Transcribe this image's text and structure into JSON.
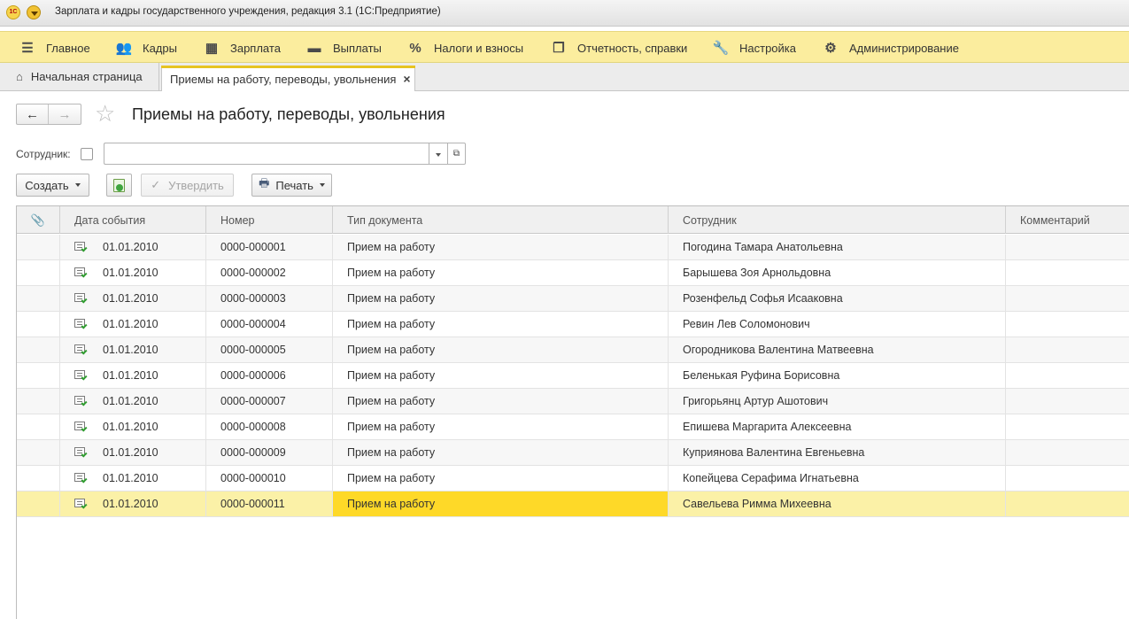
{
  "app": {
    "title": "Зарплата и кадры государственного учреждения, редакция 3.1  (1С:Предприятие)",
    "logo_text": "1С"
  },
  "sections": [
    {
      "label": "Главное",
      "icon": "hamburger-menu-icon"
    },
    {
      "label": "Кадры",
      "icon": "people-icon"
    },
    {
      "label": "Зарплата",
      "icon": "calculator-icon"
    },
    {
      "label": "Выплаты",
      "icon": "wallet-icon"
    },
    {
      "label": "Налоги и взносы",
      "icon": "percent-icon"
    },
    {
      "label": "Отчетность, справки",
      "icon": "reports-icon"
    },
    {
      "label": "Настройка",
      "icon": "wrench-icon"
    },
    {
      "label": "Администрирование",
      "icon": "gear-icon"
    }
  ],
  "tabs": {
    "home": "Начальная страница",
    "active": "Приемы на работу, переводы, увольнения",
    "close_glyph": "×"
  },
  "form": {
    "title": "Приемы на работу, переводы, увольнения",
    "filter_label": "Сотрудник:",
    "filter_value": "",
    "filter_checked": false
  },
  "toolbar": {
    "create": "Создать",
    "approve": "Утвердить",
    "print": "Печать"
  },
  "grid": {
    "columns": [
      "Дата события",
      "Номер",
      "Тип документа",
      "Сотрудник",
      "Комментарий"
    ],
    "rows": [
      {
        "date": "01.01.2010",
        "number": "0000-000001",
        "type": "Прием на работу",
        "employee": "Погодина Тамара Анатольевна",
        "comment": ""
      },
      {
        "date": "01.01.2010",
        "number": "0000-000002",
        "type": "Прием на работу",
        "employee": "Барышева Зоя Арнольдовна",
        "comment": ""
      },
      {
        "date": "01.01.2010",
        "number": "0000-000003",
        "type": "Прием на работу",
        "employee": "Розенфельд Софья Исааковна",
        "comment": ""
      },
      {
        "date": "01.01.2010",
        "number": "0000-000004",
        "type": "Прием на работу",
        "employee": "Ревин Лев Соломонович",
        "comment": ""
      },
      {
        "date": "01.01.2010",
        "number": "0000-000005",
        "type": "Прием на работу",
        "employee": "Огородникова Валентина Матвеевна",
        "comment": ""
      },
      {
        "date": "01.01.2010",
        "number": "0000-000006",
        "type": "Прием на работу",
        "employee": "Беленькая Руфина Борисовна",
        "comment": ""
      },
      {
        "date": "01.01.2010",
        "number": "0000-000007",
        "type": "Прием на работу",
        "employee": "Григорьянц Артур Ашотович",
        "comment": ""
      },
      {
        "date": "01.01.2010",
        "number": "0000-000008",
        "type": "Прием на работу",
        "employee": "Епишева Маргарита Алексеевна",
        "comment": ""
      },
      {
        "date": "01.01.2010",
        "number": "0000-000009",
        "type": "Прием на работу",
        "employee": "Куприянова Валентина Евгеньевна",
        "comment": ""
      },
      {
        "date": "01.01.2010",
        "number": "0000-000010",
        "type": "Прием на работу",
        "employee": "Копейцева Серафима Игнатьевна",
        "comment": ""
      },
      {
        "date": "01.01.2010",
        "number": "0000-000011",
        "type": "Прием на работу",
        "employee": "Савельева Римма Михеевна",
        "comment": ""
      }
    ],
    "selected_row": 10
  }
}
